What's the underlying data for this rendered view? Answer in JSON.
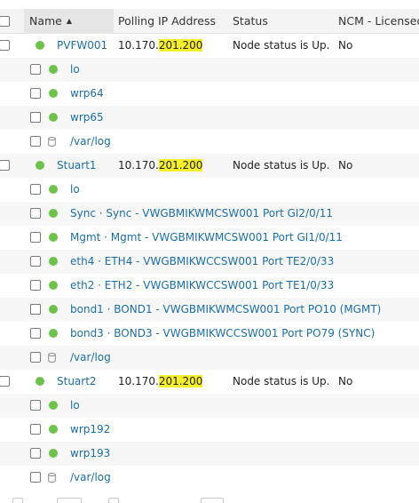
{
  "columns": {
    "name": "Name",
    "polling_ip": "Polling IP Address",
    "status": "Status",
    "ncm": "NCM - Licensed"
  },
  "nodes": [
    {
      "name": "PVFW001",
      "ip_prefix": "10.170.",
      "ip_highlight": "201.200",
      "status": "Node status is Up.",
      "ncm": "No",
      "children": [
        {
          "kind": "interface",
          "label": "lo"
        },
        {
          "kind": "interface",
          "label": "wrp64"
        },
        {
          "kind": "interface",
          "label": "wrp65"
        },
        {
          "kind": "volume",
          "label": "/var/log"
        }
      ]
    },
    {
      "name": "Stuart1",
      "ip_prefix": "10.170.",
      "ip_highlight": "201.200",
      "status": "Node status is Up.",
      "ncm": "No",
      "children": [
        {
          "kind": "interface",
          "label": "lo"
        },
        {
          "kind": "interface",
          "label": "Sync · Sync - VWGBMIKWMCSW001 Port GI2/0/11"
        },
        {
          "kind": "interface",
          "label": "Mgmt · Mgmt - VWGBMIKWMCSW001 Port GI1/0/11"
        },
        {
          "kind": "interface",
          "label": "eth4 · ETH4 - VWGBMIKWCCSW001 Port TE2/0/33"
        },
        {
          "kind": "interface",
          "label": "eth2 · ETH2 - VWGBMIKWCCSW001 Port TE1/0/33"
        },
        {
          "kind": "interface",
          "label": "bond1 · BOND1 - VWGBMIKWMCSW001 Port PO10 (MGMT)"
        },
        {
          "kind": "interface",
          "label": "bond3 · BOND3 - VWGBMIKWCCSW001 Port PO79 (SYNC)"
        },
        {
          "kind": "volume",
          "label": "/var/log"
        }
      ]
    },
    {
      "name": "Stuart2",
      "ip_prefix": "10.170.",
      "ip_highlight": "201.200",
      "status": "Node status is Up.",
      "ncm": "No",
      "children": [
        {
          "kind": "interface",
          "label": "lo"
        },
        {
          "kind": "interface",
          "label": "wrp192"
        },
        {
          "kind": "interface",
          "label": "wrp193"
        },
        {
          "kind": "volume",
          "label": "/var/log"
        }
      ]
    }
  ],
  "colors": {
    "status_up": "#6dc24b",
    "link": "#1b6ea8",
    "highlight": "#f5ee2a"
  },
  "icons": {
    "status": "green-status-dot-icon",
    "volume": "database-cylinder-icon",
    "sort": "sort-ascending-icon"
  }
}
